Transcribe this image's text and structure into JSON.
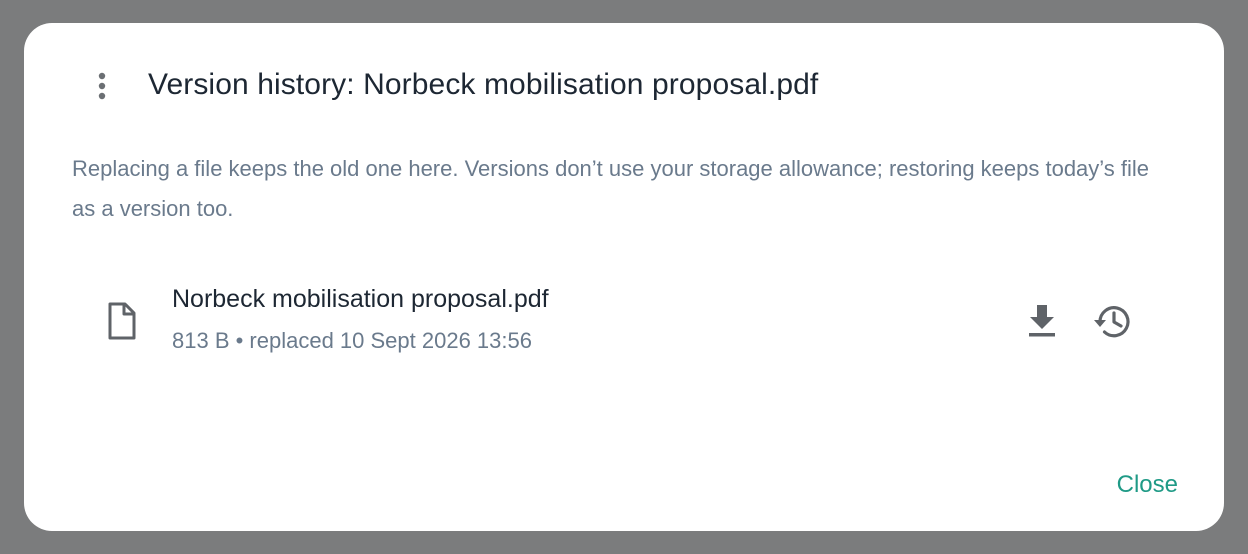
{
  "dialog": {
    "title": "Version history: Norbeck mobilisation proposal.pdf",
    "description": "Replacing a file keeps the old one here. Versions don’t use your storage allowance; restoring keeps today’s file as a version too.",
    "menu_icon": "kebab-menu-icon",
    "close_label": "Close"
  },
  "versions": [
    {
      "file_name": "Norbeck mobilisation proposal.pdf",
      "meta": "813 B • replaced 10 Sept 2026 13:56",
      "icon": "file-icon",
      "actions": [
        "download-icon",
        "restore-history-icon"
      ]
    }
  ],
  "colors": {
    "backdrop": "#7b7c7d",
    "dialog_bg": "#ffffff",
    "text_primary": "#1d2733",
    "text_secondary": "#6a7a8c",
    "accent": "#1f9a86",
    "icon": "#5f6368"
  }
}
